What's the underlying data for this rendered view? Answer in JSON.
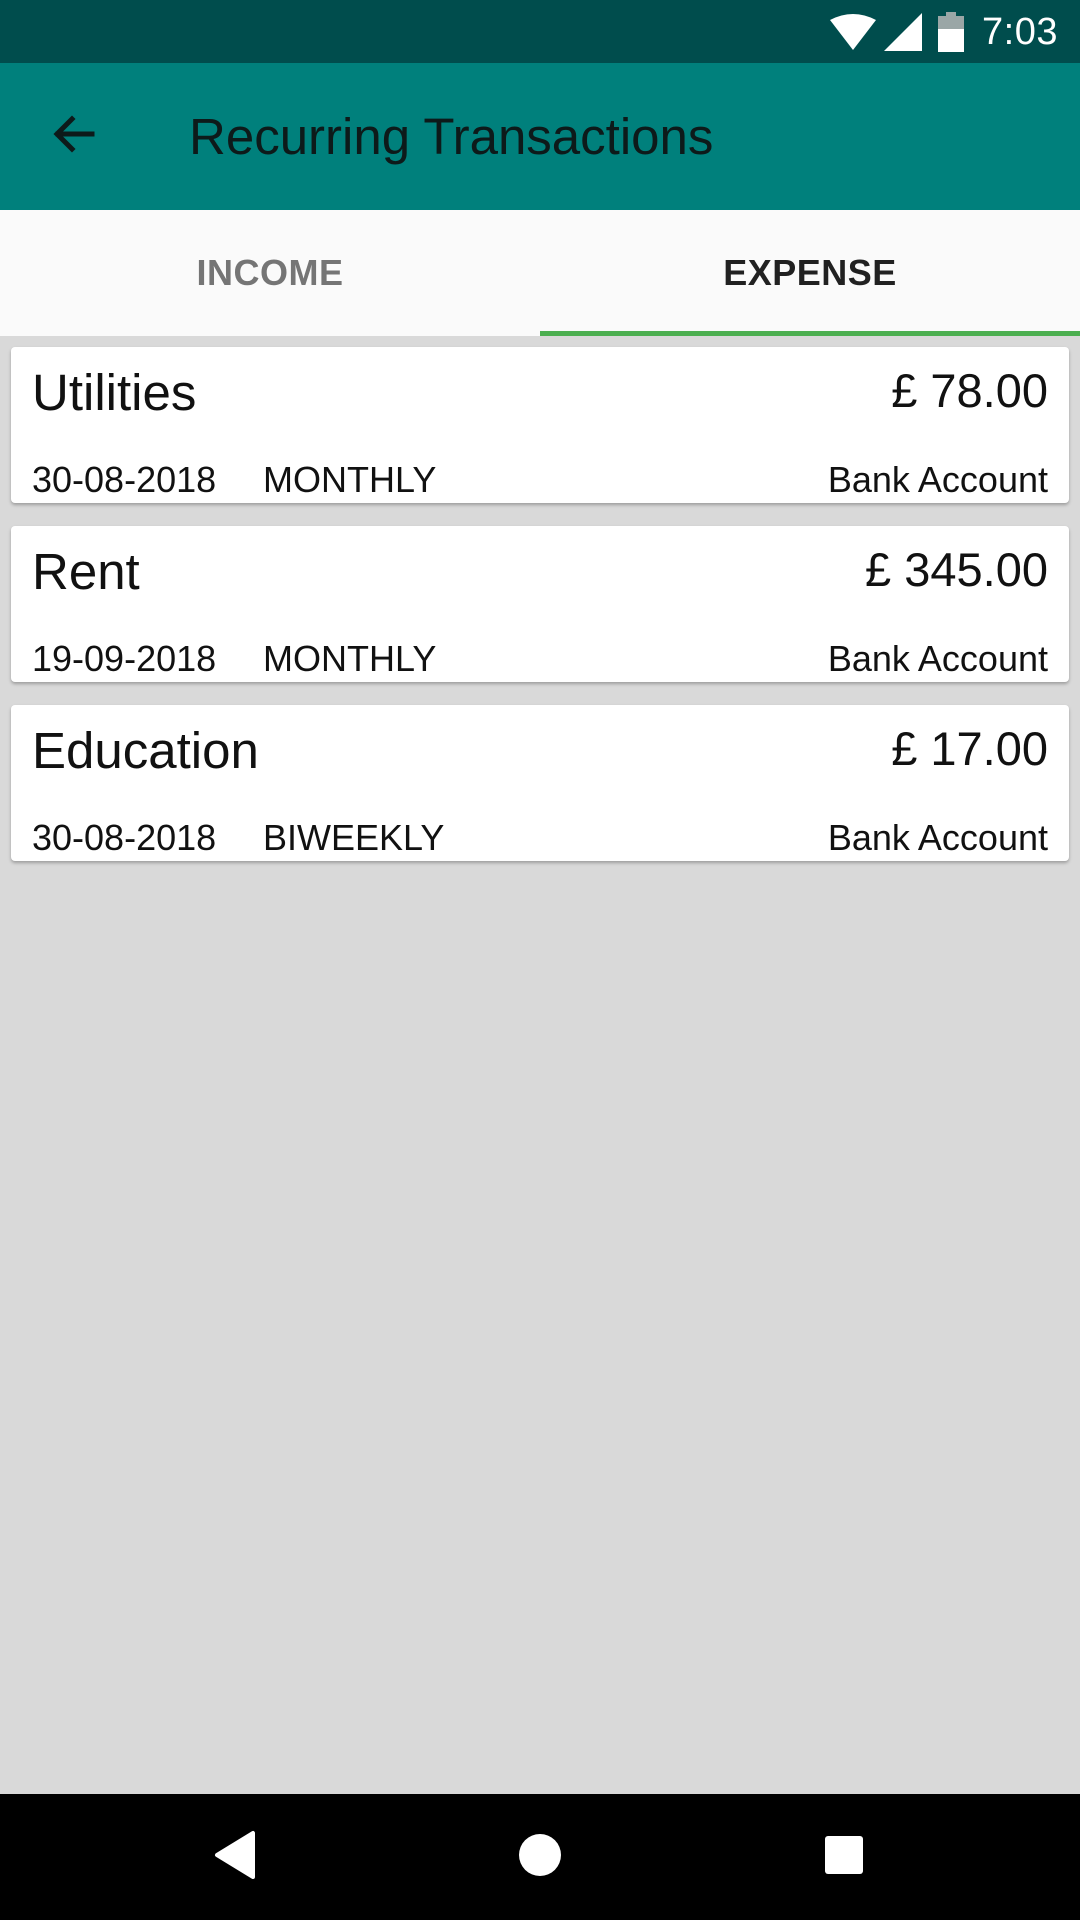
{
  "status_bar": {
    "time": "7:03",
    "icons": [
      "wifi-icon",
      "signal-icon",
      "battery-icon"
    ],
    "background": "#004d4d"
  },
  "app_bar": {
    "title": "Recurring Transactions",
    "back_icon": "arrow-back-icon",
    "background": "#00807c"
  },
  "tabs": [
    {
      "label": "INCOME",
      "selected": false
    },
    {
      "label": "EXPENSE",
      "selected": true
    }
  ],
  "colors": {
    "accent": "#4caf50",
    "list_background": "#d9d9d9"
  },
  "transactions": [
    {
      "name": "Utilities",
      "amount": "£ 78.00",
      "date": "30-08-2018",
      "frequency": "MONTHLY",
      "account": "Bank Account"
    },
    {
      "name": "Rent",
      "amount": "£ 345.00",
      "date": "19-09-2018",
      "frequency": "MONTHLY",
      "account": "Bank Account"
    },
    {
      "name": "Education",
      "amount": "£ 17.00",
      "date": "30-08-2018",
      "frequency": "BIWEEKLY",
      "account": "Bank Account"
    }
  ],
  "nav_bar": {
    "icons": [
      "nav-back-icon",
      "nav-home-icon",
      "nav-recents-icon"
    ]
  }
}
